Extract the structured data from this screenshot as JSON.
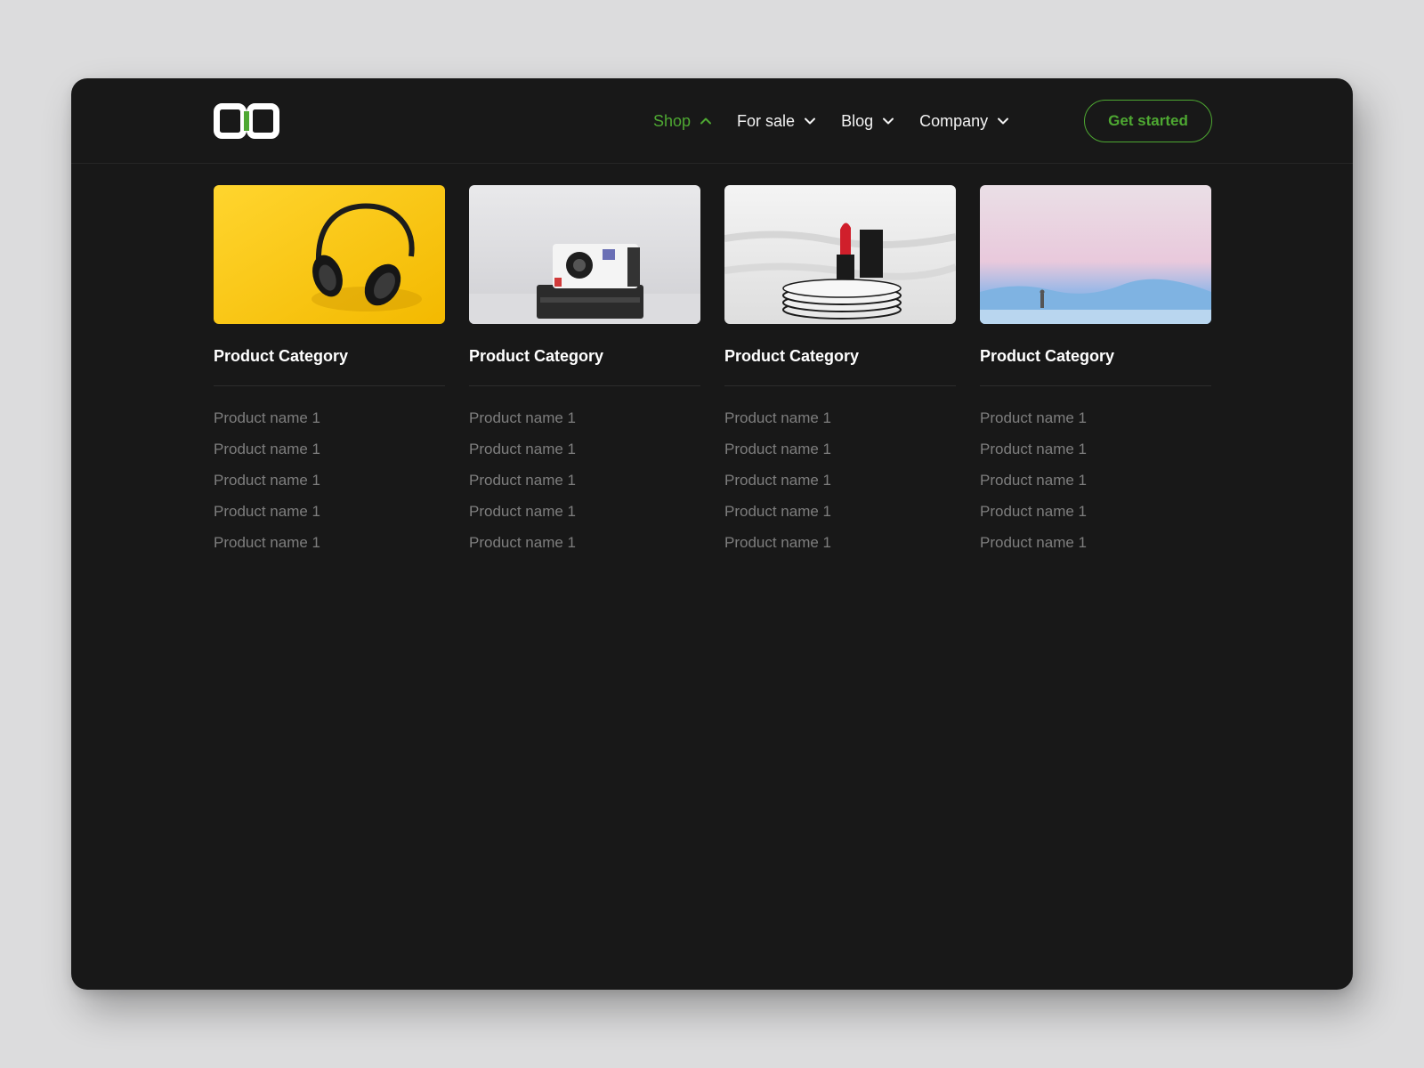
{
  "brand": {
    "logo_icon": "brand-logo-icon",
    "accent_color": "#4ea832"
  },
  "nav": {
    "items": [
      {
        "label": "Shop",
        "active": true,
        "icon": "chevron-up-icon"
      },
      {
        "label": "For sale",
        "active": false,
        "icon": "chevron-down-icon"
      },
      {
        "label": "Blog",
        "active": false,
        "icon": "chevron-down-icon"
      },
      {
        "label": "Company",
        "active": false,
        "icon": "chevron-down-icon"
      }
    ],
    "cta_label": "Get started"
  },
  "categories": [
    {
      "title": "Product Category",
      "image": "headphones-image",
      "products": [
        "Product name 1",
        "Product name 1",
        "Product name 1",
        "Product name 1",
        "Product name 1"
      ]
    },
    {
      "title": "Product Category",
      "image": "instant-camera-image",
      "products": [
        "Product name 1",
        "Product name 1",
        "Product name 1",
        "Product name 1",
        "Product name 1"
      ]
    },
    {
      "title": "Product Category",
      "image": "lipstick-image",
      "products": [
        "Product name 1",
        "Product name 1",
        "Product name 1",
        "Product name 1",
        "Product name 1"
      ]
    },
    {
      "title": "Product Category",
      "image": "landscape-image",
      "products": [
        "Product name 1",
        "Product name 1",
        "Product name 1",
        "Product name 1",
        "Product name 1"
      ]
    }
  ]
}
